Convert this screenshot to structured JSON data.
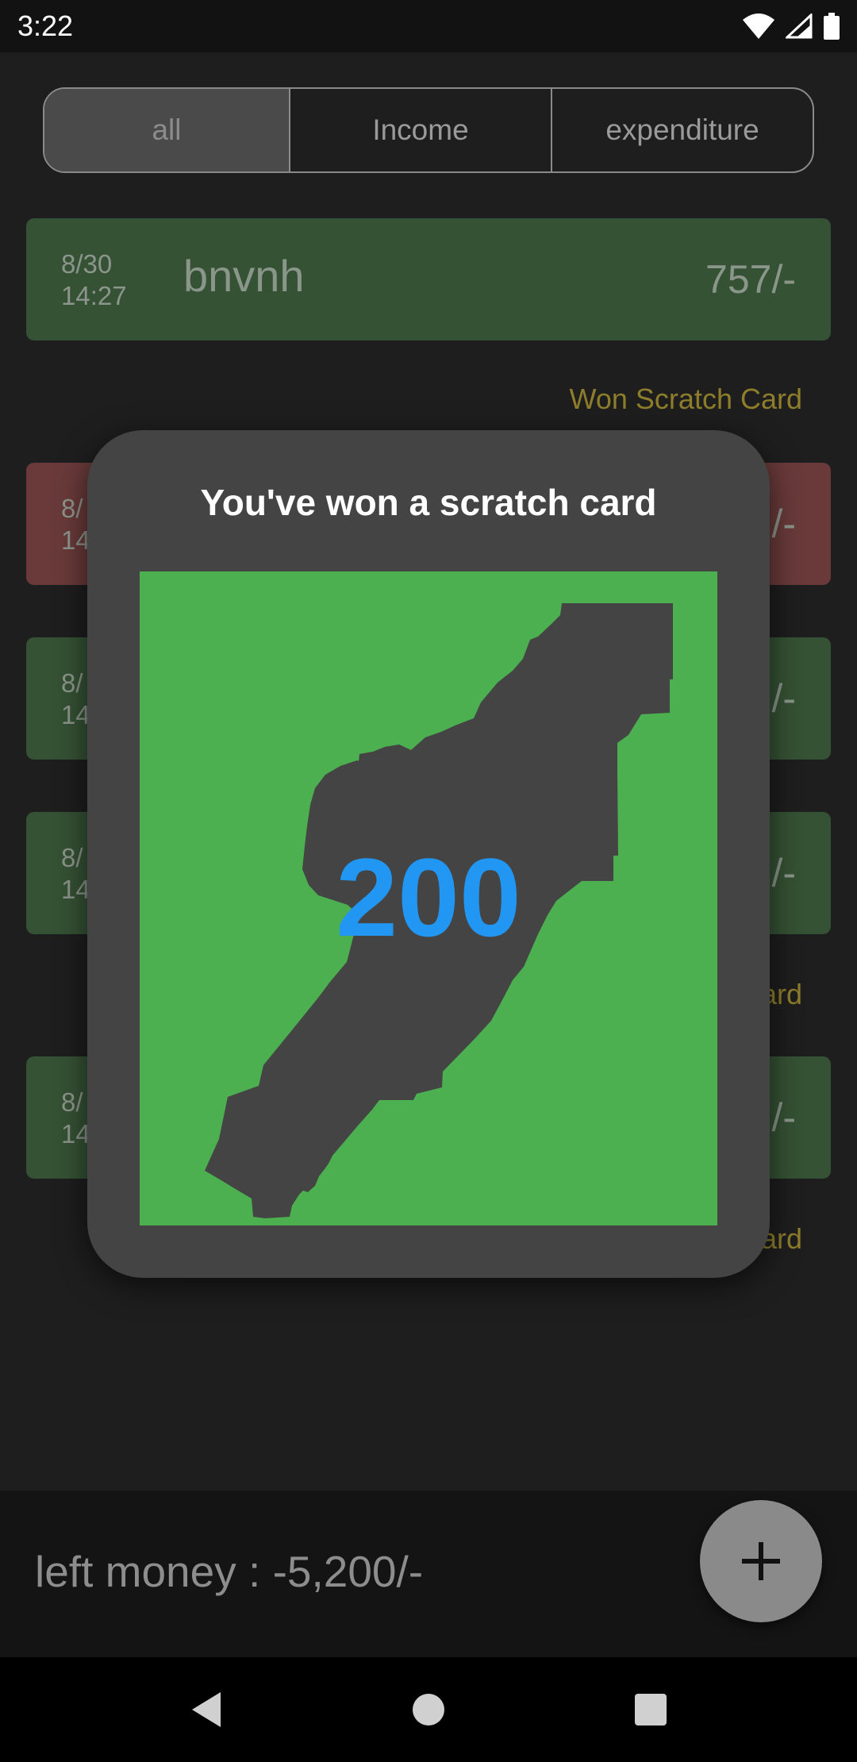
{
  "status_bar": {
    "time": "3:22",
    "icons": [
      "wifi-icon",
      "signal-icon",
      "battery-icon"
    ]
  },
  "filter_tabs": [
    {
      "label": "all",
      "selected": true
    },
    {
      "label": "Income",
      "selected": false
    },
    {
      "label": "expenditure",
      "selected": false
    }
  ],
  "transactions": [
    {
      "date": "8/30",
      "time": "14:27",
      "title": "bnvnh",
      "amount": "757/-",
      "type": "income"
    },
    {
      "date": "8/",
      "time": "14",
      "title": "",
      "amount": "/-",
      "type": "expenditure"
    },
    {
      "date": "8/",
      "time": "14",
      "title": "",
      "amount": "/-",
      "type": "income"
    },
    {
      "date": "8/",
      "time": "14",
      "title": "",
      "amount": "/-",
      "type": "income"
    },
    {
      "date": "8/",
      "time": "14",
      "title": "",
      "amount": "/-",
      "type": "income"
    }
  ],
  "won_labels": [
    "Won Scratch Card",
    "ard",
    "ard"
  ],
  "dialog": {
    "title": "You've won a scratch card",
    "prize": "200"
  },
  "footer": {
    "left_money": "left money : -5,200/-",
    "fab_icon": "plus-icon"
  },
  "colors": {
    "accent_green": "#4caf50",
    "prize_blue": "#2196f3",
    "won_gold": "#8e7d2b"
  }
}
